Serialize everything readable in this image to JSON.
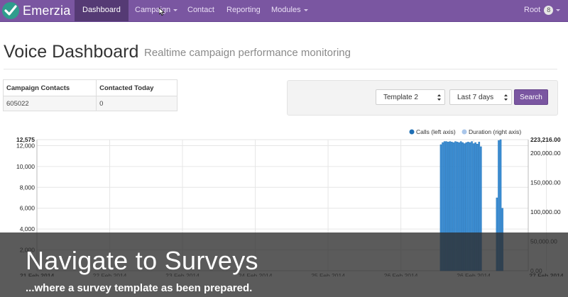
{
  "navbar": {
    "brand": "Emerzia",
    "items": [
      {
        "label": "Dashboard",
        "active": true
      },
      {
        "label": "Campaign",
        "dropdown": true
      },
      {
        "label": "Contact"
      },
      {
        "label": "Reporting"
      },
      {
        "label": "Modules",
        "dropdown": true
      }
    ],
    "user": {
      "label": "Root",
      "badge": "8"
    },
    "accent_color": "#7a56a1"
  },
  "header": {
    "title": "Voice Dashboard",
    "subtitle": "Realtime campaign performance monitoring"
  },
  "stats_table": {
    "headers": [
      "Campaign Contacts",
      "Contacted Today"
    ],
    "rows": [
      [
        "605022",
        "0"
      ]
    ]
  },
  "filters": {
    "template_select": "Template 2",
    "range_select": "Last 7 days",
    "search_label": "Search"
  },
  "chart_data": {
    "type": "bar",
    "legend": [
      {
        "name": "Calls (left axis)",
        "color": "#1f6fb5"
      },
      {
        "name": "Duration (right axis)",
        "color": "#a9c6ea"
      }
    ],
    "legend_position": "top-right",
    "x_labels": [
      "21 Feb 2014",
      "22 Feb 2014",
      "23 Feb 2014",
      "24 Feb 2014",
      "25 Feb 2014",
      "26 Feb 2014",
      "26 Feb 2014",
      "27 Feb 2014"
    ],
    "x_range": [
      0,
      6.75
    ],
    "left_axis": {
      "range": [
        0,
        12575
      ],
      "ticks": [
        {
          "label": "12,575",
          "value": 12575
        },
        {
          "label": "12,000",
          "value": 12000
        },
        {
          "label": "10,000",
          "value": 10000
        },
        {
          "label": "8,000",
          "value": 8000
        },
        {
          "label": "6,000",
          "value": 6000
        },
        {
          "label": "4,000",
          "value": 4000
        },
        {
          "label": "2,000",
          "value": 2000
        }
      ]
    },
    "right_axis": {
      "range": [
        0,
        223216
      ],
      "ticks": [
        {
          "label": "223,216.00",
          "value": 223216
        },
        {
          "label": "200,000.00",
          "value": 200000
        },
        {
          "label": "150,000.00",
          "value": 150000
        },
        {
          "label": "100,000.00",
          "value": 100000
        },
        {
          "label": "50,000.00",
          "value": 50000
        },
        {
          "label": "0.00",
          "value": 0
        }
      ]
    },
    "bar_groups": [
      {
        "x": [
          5.55,
          5.575,
          5.6,
          5.625,
          5.65,
          5.675,
          5.7,
          5.725,
          5.75,
          5.775,
          5.8,
          5.825,
          5.85,
          5.875,
          5.9,
          5.925,
          5.95,
          5.975,
          6.0,
          6.025,
          6.05,
          6.075,
          6.1
        ],
        "values": [
          12100,
          12300,
          12400,
          12400,
          12350,
          12400,
          12350,
          12300,
          12400,
          12350,
          12300,
          12400,
          12300,
          12200,
          12300,
          12350,
          12300,
          12400,
          12200,
          12300,
          12150,
          12350,
          11900
        ]
      },
      {
        "x": [
          6.32,
          6.345,
          6.37,
          6.395
        ],
        "values": [
          7000,
          12500,
          12575,
          6000
        ]
      }
    ],
    "grid": true
  },
  "caption": {
    "title": "Navigate to Surveys",
    "subtitle": "...where a survey template as been prepared."
  }
}
